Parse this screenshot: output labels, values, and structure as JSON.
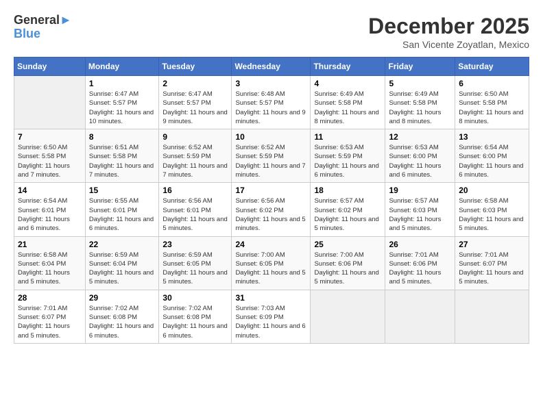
{
  "logo": {
    "line1": "General",
    "line2": "Blue"
  },
  "title": "December 2025",
  "location": "San Vicente Zoyatlan, Mexico",
  "weekdays": [
    "Sunday",
    "Monday",
    "Tuesday",
    "Wednesday",
    "Thursday",
    "Friday",
    "Saturday"
  ],
  "weeks": [
    [
      {
        "day": "",
        "empty": true
      },
      {
        "day": "1",
        "sunrise": "6:47 AM",
        "sunset": "5:57 PM",
        "daylight": "11 hours and 10 minutes."
      },
      {
        "day": "2",
        "sunrise": "6:47 AM",
        "sunset": "5:57 PM",
        "daylight": "11 hours and 9 minutes."
      },
      {
        "day": "3",
        "sunrise": "6:48 AM",
        "sunset": "5:57 PM",
        "daylight": "11 hours and 9 minutes."
      },
      {
        "day": "4",
        "sunrise": "6:49 AM",
        "sunset": "5:58 PM",
        "daylight": "11 hours and 8 minutes."
      },
      {
        "day": "5",
        "sunrise": "6:49 AM",
        "sunset": "5:58 PM",
        "daylight": "11 hours and 8 minutes."
      },
      {
        "day": "6",
        "sunrise": "6:50 AM",
        "sunset": "5:58 PM",
        "daylight": "11 hours and 8 minutes."
      }
    ],
    [
      {
        "day": "7",
        "sunrise": "6:50 AM",
        "sunset": "5:58 PM",
        "daylight": "11 hours and 7 minutes."
      },
      {
        "day": "8",
        "sunrise": "6:51 AM",
        "sunset": "5:58 PM",
        "daylight": "11 hours and 7 minutes."
      },
      {
        "day": "9",
        "sunrise": "6:52 AM",
        "sunset": "5:59 PM",
        "daylight": "11 hours and 7 minutes."
      },
      {
        "day": "10",
        "sunrise": "6:52 AM",
        "sunset": "5:59 PM",
        "daylight": "11 hours and 7 minutes."
      },
      {
        "day": "11",
        "sunrise": "6:53 AM",
        "sunset": "5:59 PM",
        "daylight": "11 hours and 6 minutes."
      },
      {
        "day": "12",
        "sunrise": "6:53 AM",
        "sunset": "6:00 PM",
        "daylight": "11 hours and 6 minutes."
      },
      {
        "day": "13",
        "sunrise": "6:54 AM",
        "sunset": "6:00 PM",
        "daylight": "11 hours and 6 minutes."
      }
    ],
    [
      {
        "day": "14",
        "sunrise": "6:54 AM",
        "sunset": "6:01 PM",
        "daylight": "11 hours and 6 minutes."
      },
      {
        "day": "15",
        "sunrise": "6:55 AM",
        "sunset": "6:01 PM",
        "daylight": "11 hours and 6 minutes."
      },
      {
        "day": "16",
        "sunrise": "6:56 AM",
        "sunset": "6:01 PM",
        "daylight": "11 hours and 5 minutes."
      },
      {
        "day": "17",
        "sunrise": "6:56 AM",
        "sunset": "6:02 PM",
        "daylight": "11 hours and 5 minutes."
      },
      {
        "day": "18",
        "sunrise": "6:57 AM",
        "sunset": "6:02 PM",
        "daylight": "11 hours and 5 minutes."
      },
      {
        "day": "19",
        "sunrise": "6:57 AM",
        "sunset": "6:03 PM",
        "daylight": "11 hours and 5 minutes."
      },
      {
        "day": "20",
        "sunrise": "6:58 AM",
        "sunset": "6:03 PM",
        "daylight": "11 hours and 5 minutes."
      }
    ],
    [
      {
        "day": "21",
        "sunrise": "6:58 AM",
        "sunset": "6:04 PM",
        "daylight": "11 hours and 5 minutes."
      },
      {
        "day": "22",
        "sunrise": "6:59 AM",
        "sunset": "6:04 PM",
        "daylight": "11 hours and 5 minutes."
      },
      {
        "day": "23",
        "sunrise": "6:59 AM",
        "sunset": "6:05 PM",
        "daylight": "11 hours and 5 minutes."
      },
      {
        "day": "24",
        "sunrise": "7:00 AM",
        "sunset": "6:05 PM",
        "daylight": "11 hours and 5 minutes."
      },
      {
        "day": "25",
        "sunrise": "7:00 AM",
        "sunset": "6:06 PM",
        "daylight": "11 hours and 5 minutes."
      },
      {
        "day": "26",
        "sunrise": "7:01 AM",
        "sunset": "6:06 PM",
        "daylight": "11 hours and 5 minutes."
      },
      {
        "day": "27",
        "sunrise": "7:01 AM",
        "sunset": "6:07 PM",
        "daylight": "11 hours and 5 minutes."
      }
    ],
    [
      {
        "day": "28",
        "sunrise": "7:01 AM",
        "sunset": "6:07 PM",
        "daylight": "11 hours and 5 minutes."
      },
      {
        "day": "29",
        "sunrise": "7:02 AM",
        "sunset": "6:08 PM",
        "daylight": "11 hours and 6 minutes."
      },
      {
        "day": "30",
        "sunrise": "7:02 AM",
        "sunset": "6:08 PM",
        "daylight": "11 hours and 6 minutes."
      },
      {
        "day": "31",
        "sunrise": "7:03 AM",
        "sunset": "6:09 PM",
        "daylight": "11 hours and 6 minutes."
      },
      {
        "day": "",
        "empty": true
      },
      {
        "day": "",
        "empty": true
      },
      {
        "day": "",
        "empty": true
      }
    ]
  ],
  "labels": {
    "sunrise": "Sunrise:",
    "sunset": "Sunset:",
    "daylight": "Daylight:"
  }
}
